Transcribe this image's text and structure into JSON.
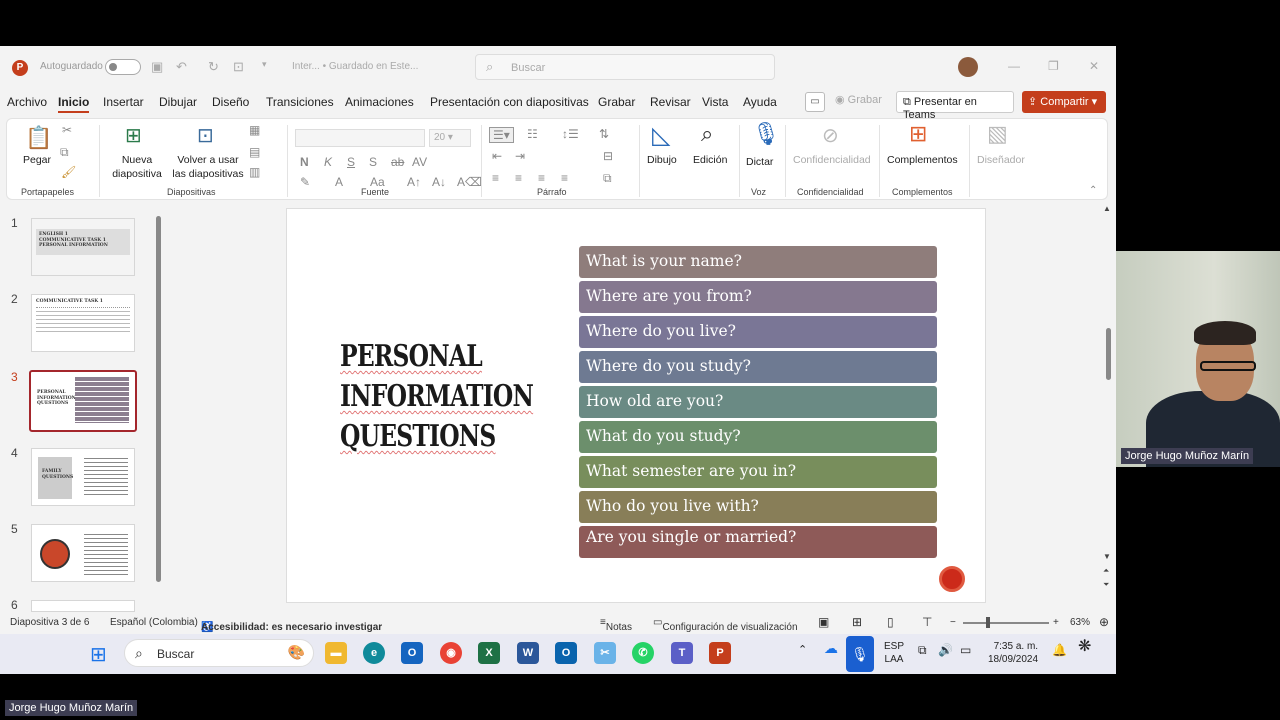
{
  "titlebar": {
    "autosave_label": "Autoguardado",
    "doc_name": "Inter... • Guardado en Este...",
    "search_placeholder": "Buscar"
  },
  "menu": {
    "items": [
      "Archivo",
      "Inicio",
      "Insertar",
      "Dibujar",
      "Diseño",
      "Transiciones",
      "Animaciones",
      "Presentación con diapositivas",
      "Grabar",
      "Revisar",
      "Vista",
      "Ayuda"
    ],
    "active": "Inicio",
    "record_label": "Grabar",
    "teams_label": "Presentar en Teams",
    "share_label": "Compartir"
  },
  "ribbon": {
    "paste": "Pegar",
    "new_slide": "Nueva diapositiva",
    "reuse": "Volver a usar las diapositivas",
    "font_size": "20",
    "draw": "Dibujo",
    "edit": "Edición",
    "dictate": "Dictar",
    "confidential": "Confidencialidad",
    "addins": "Complementos",
    "designer": "Diseñador",
    "groups": {
      "clipboard": "Portapapeles",
      "slides": "Diapositivas",
      "font": "Fuente",
      "paragraph": "Párrafo",
      "voice": "Voz",
      "confidential": "Confidencialidad",
      "addins": "Complementos"
    },
    "format_letters": {
      "bold": "N",
      "italic": "K",
      "underline": "S",
      "strike": "S"
    }
  },
  "thumbnails": [
    {
      "num": "1",
      "lines": [
        "ENGLISH 1",
        "COMMUNICATIVE TASK 1",
        "PERSONAL INFORMATION"
      ]
    },
    {
      "num": "2",
      "lines": [
        "COMMUNICATIVE TASK 1"
      ]
    },
    {
      "num": "3",
      "lines": [
        "PERSONAL",
        "INFORMATION",
        "QUESTIONS"
      ]
    },
    {
      "num": "4",
      "lines": [
        "FAMILY",
        "QUESTIONS"
      ]
    },
    {
      "num": "5",
      "lines": []
    },
    {
      "num": "6",
      "lines": []
    }
  ],
  "slide": {
    "title_lines": [
      "PERSONAL",
      "INFORMATION",
      "QUESTIONS"
    ],
    "questions": [
      {
        "text": "What is your name?",
        "color": "#8f7d7b"
      },
      {
        "text": "Where are you from?",
        "color": "#85788f"
      },
      {
        "text": "Where do you live?",
        "color": "#7a7696"
      },
      {
        "text": "Where do you study?",
        "color": "#6e7a92"
      },
      {
        "text": "How old are you?",
        "color": "#6a8a84"
      },
      {
        "text": "What do you study?",
        "color": "#6c8f6c"
      },
      {
        "text": "What semester are you in?",
        "color": "#788e5c"
      },
      {
        "text": "Who do you live with?",
        "color": "#887e58"
      },
      {
        "text": "Are you single or married?",
        "color": "#8e5a58"
      }
    ]
  },
  "status": {
    "slide_info": "Diapositiva 3 de 6",
    "language": "Español (Colombia)",
    "accessibility": "Accesibilidad: es necesario investigar",
    "notes": "Notas",
    "display_settings": "Configuración de visualización",
    "zoom": "63%"
  },
  "taskbar": {
    "search_placeholder": "Buscar",
    "lang_line1": "ESP",
    "lang_line2": "LAA",
    "time": "7:35 a. m.",
    "date": "18/09/2024"
  },
  "participant": {
    "name": "Jorge Hugo Muñoz Marín"
  }
}
